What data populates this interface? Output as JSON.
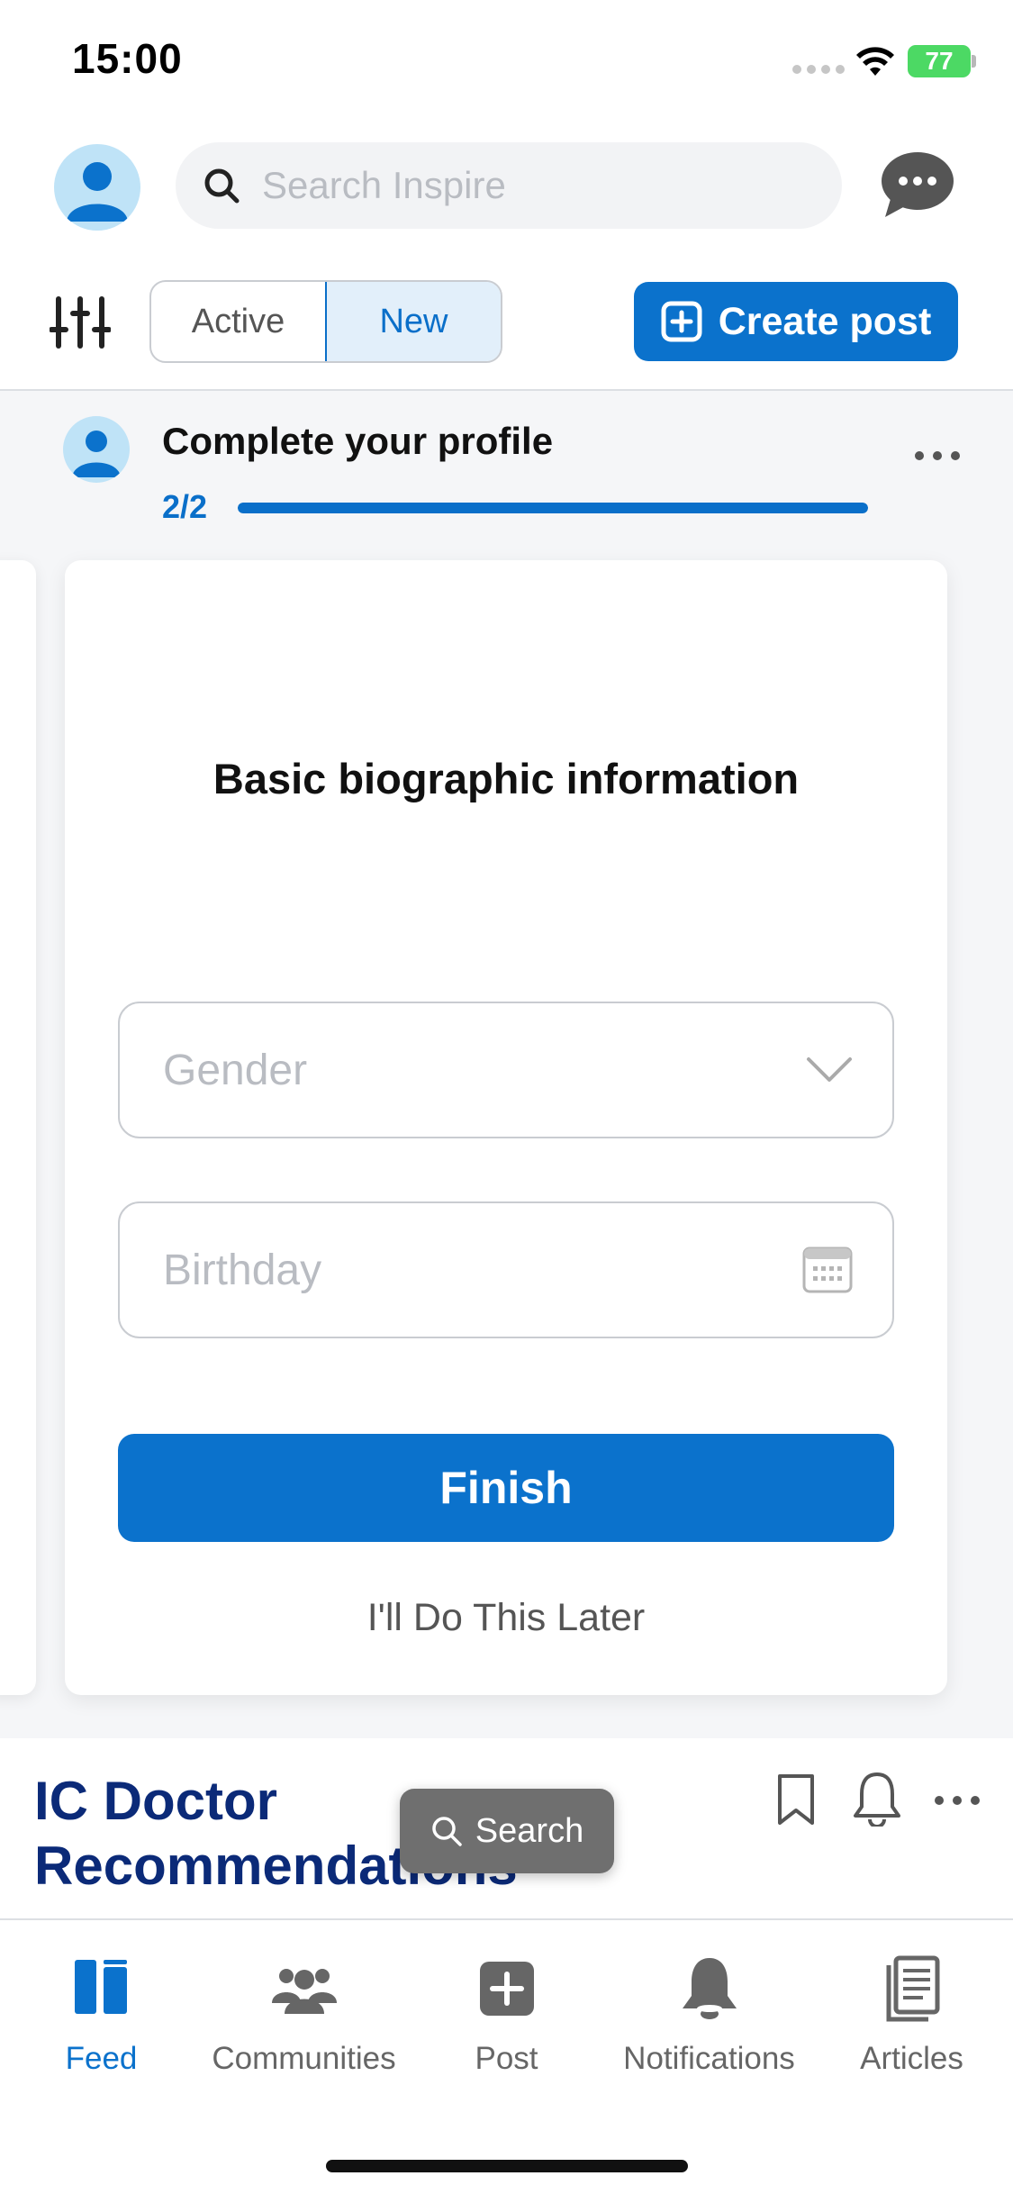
{
  "status_bar": {
    "time": "15:00",
    "battery": "77"
  },
  "header": {
    "search_placeholder": "Search Inspire"
  },
  "filters": {
    "active_label": "Active",
    "new_label": "New",
    "selected": "New"
  },
  "create_post_label": "Create post",
  "profile": {
    "title": "Complete your profile",
    "progress_text": "2/2",
    "progress_fraction": 1.0
  },
  "card": {
    "title": "Basic biographic information",
    "gender_placeholder": "Gender",
    "birthday_placeholder": "Birthday",
    "finish_label": "Finish",
    "later_label": "I'll Do This Later"
  },
  "section": {
    "title": "IC Doctor Recommendations"
  },
  "floating_search_label": "Search",
  "tabs": [
    {
      "label": "Feed",
      "icon": "feed-icon",
      "active": true
    },
    {
      "label": "Communities",
      "icon": "communities-icon",
      "active": false
    },
    {
      "label": "Post",
      "icon": "post-icon",
      "active": false
    },
    {
      "label": "Notifications",
      "icon": "bell-icon",
      "active": false
    },
    {
      "label": "Articles",
      "icon": "articles-icon",
      "active": false
    }
  ],
  "colors": {
    "accent": "#0b72cc",
    "section_title": "#0b2a78",
    "battery": "#4cd964"
  }
}
